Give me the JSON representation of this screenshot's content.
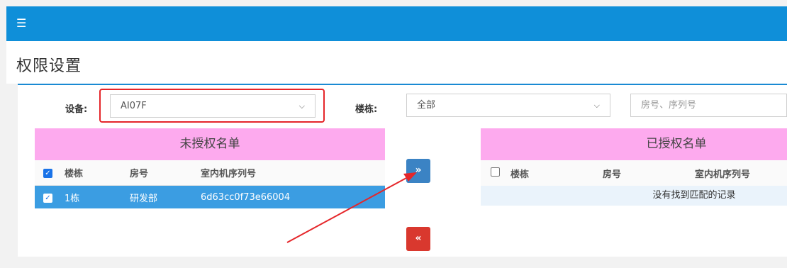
{
  "topbar": {
    "menu_icon": "☰"
  },
  "page": {
    "title": "权限设置"
  },
  "filters": {
    "device_label": "设备:",
    "device_value": "AI07F",
    "building_label": "楼栋:",
    "building_value": "全部",
    "search_placeholder": "房号、序列号"
  },
  "unauthorized": {
    "title": "未授权名单",
    "columns": [
      "楼栋",
      "房号",
      "室内机序列号"
    ],
    "rows": [
      {
        "building": "1栋",
        "room": "研发部",
        "serial": "6d63cc0f73e66004",
        "checked": true
      }
    ]
  },
  "authorized": {
    "title": "已授权名单",
    "columns": [
      "楼栋",
      "房号",
      "室内机序列号"
    ],
    "empty_text": "没有找到匹配的记录"
  },
  "buttons": {
    "move_right": "»",
    "move_left": "«"
  },
  "colors": {
    "topbar": "#0f8fd9",
    "panel_head": "#fdaaee",
    "selected_row": "#3b9de2",
    "move_right": "#3b83c4",
    "move_left": "#d9382e",
    "annotation": "#e5262a"
  }
}
